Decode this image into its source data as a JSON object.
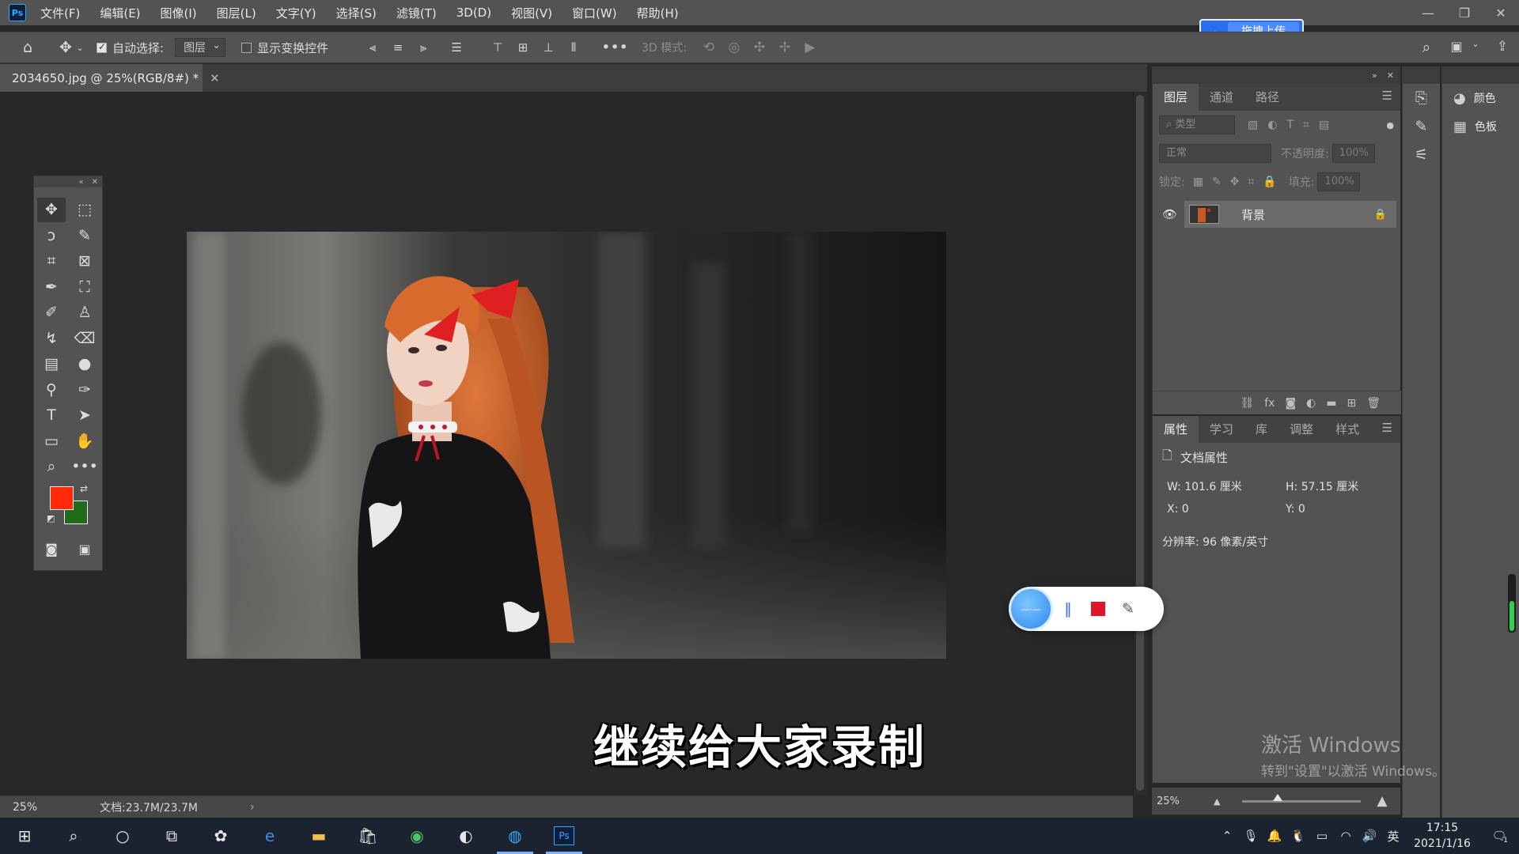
{
  "app": {
    "logo_text": "Ps"
  },
  "menu": [
    "文件(F)",
    "编辑(E)",
    "图像(I)",
    "图层(L)",
    "文字(Y)",
    "选择(S)",
    "滤镜(T)",
    "3D(D)",
    "视图(V)",
    "窗口(W)",
    "帮助(H)"
  ],
  "upload_button": {
    "label": "拖拽上传"
  },
  "options_bar": {
    "auto_select_label": "自动选择:",
    "auto_select_checked": true,
    "auto_select_value": "图层",
    "show_transform_label": "显示变换控件",
    "show_transform_checked": false,
    "mode_3d_label": "3D 模式:"
  },
  "document_tab": {
    "title": "2034650.jpg @ 25%(RGB/8#) *"
  },
  "status_bar": {
    "zoom": "25%",
    "doc_info": "文档:23.7M/23.7M"
  },
  "tools": {
    "foreground_color": "#ff2a0a",
    "background_color": "#1f6b1a"
  },
  "layers_panel": {
    "tabs": [
      "图层",
      "通道",
      "路径"
    ],
    "active_tab": 0,
    "filter_placeholder": "类型",
    "blend_mode": "正常",
    "opacity_label": "不透明度:",
    "opacity_value": "100%",
    "lock_label": "锁定:",
    "fill_label": "填充:",
    "fill_value": "100%",
    "layers": [
      {
        "name": "背景",
        "visible": true,
        "locked": true
      }
    ]
  },
  "properties_panel": {
    "tabs": [
      "属性",
      "学习",
      "库",
      "调整",
      "样式"
    ],
    "active_tab": 0,
    "title": "文档属性",
    "w": "W:  101.6 厘米",
    "h": "H:  57.15 厘米",
    "x": "X:  0",
    "y": "Y:  0",
    "resolution": "分辨率: 96 像素/英寸"
  },
  "zoom_panel": {
    "zoom": "25%",
    "slider_fraction": 0.3
  },
  "side_panels": [
    {
      "label": "颜色"
    },
    {
      "label": "色板"
    }
  ],
  "subtitle": "继续给大家录制",
  "watermark": {
    "line1": "激活 Windows",
    "line2": "转到\"设置\"以激活 Windows。"
  },
  "volume_fraction": 0.55,
  "taskbar": {
    "ime": "英",
    "time": "17:15",
    "date": "2021/1/16",
    "notification_count": "1"
  },
  "colors": {
    "ui_panel": "#535353",
    "canvas_bg": "#282828",
    "accent_blue": "#2a6ef0",
    "recorder_stop": "#e0142a"
  }
}
